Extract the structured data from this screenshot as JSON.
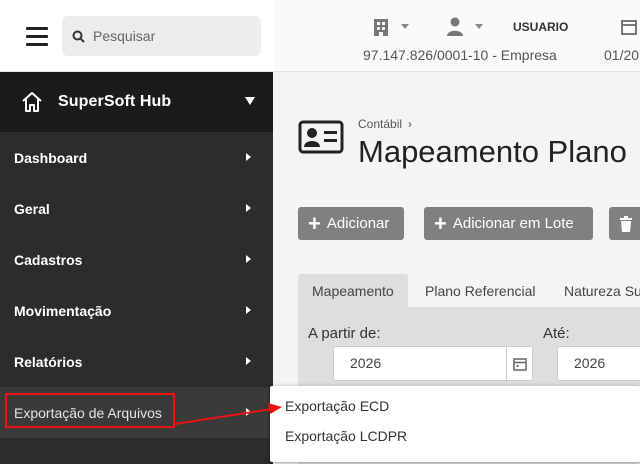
{
  "search": {
    "placeholder": "Pesquisar"
  },
  "sidebar": {
    "brand": "SuperSoft Hub",
    "items": [
      {
        "label": "Dashboard"
      },
      {
        "label": "Geral"
      },
      {
        "label": "Cadastros"
      },
      {
        "label": "Movimentação"
      },
      {
        "label": "Relatórios"
      },
      {
        "label": "Exportação de Arquivos"
      }
    ]
  },
  "topbar": {
    "username": "USUARIO",
    "company": "97.147.826/0001-10 - Empresa",
    "date": "01/20"
  },
  "main": {
    "breadcrumb": "Contábil",
    "title": "Mapeamento Plano",
    "buttons": {
      "add": "Adicionar",
      "lote": "Adicionar em Lote"
    },
    "tabs": [
      "Mapeamento",
      "Plano Referencial",
      "Natureza Su"
    ],
    "form": {
      "from_label": "A partir de:",
      "from_value": "2026",
      "to_label": "Até:",
      "to_value": "2026"
    }
  },
  "submenu": {
    "items": [
      "Exportação ECD",
      "Exportação LCDPR"
    ]
  },
  "colors": {
    "highlight": "#e11111",
    "sidebar": "#2c2c2c",
    "button": "#808080"
  }
}
